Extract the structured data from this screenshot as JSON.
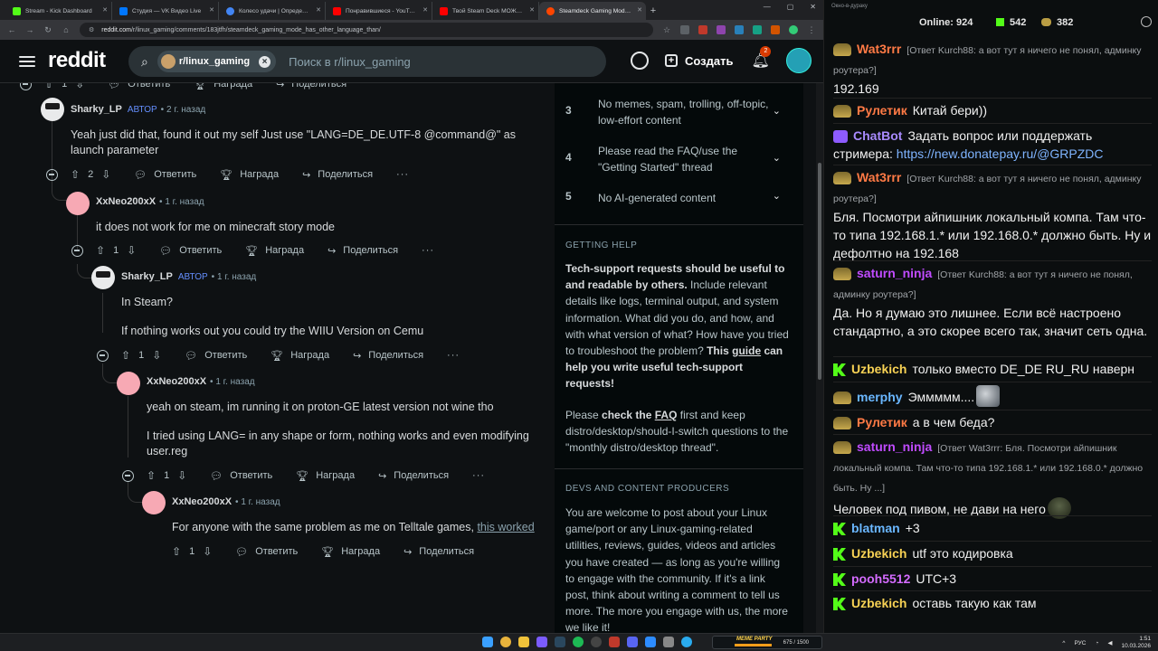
{
  "browser": {
    "tabs": [
      {
        "title": "Stream - Kick Dashboard",
        "color": "#53fc18"
      },
      {
        "title": "Студия — VK Видео Live",
        "color": "#0077ff"
      },
      {
        "title": "Колесо удачи | Определите п...",
        "color": "#4285f4"
      },
      {
        "title": "Понравившиеся - YouTube",
        "color": "#ff0000"
      },
      {
        "title": "Твой Steam Deck МОЖЕТ БОЛ...",
        "color": "#ff0000"
      },
      {
        "title": "Steamdeck Gaming Mode has ...",
        "color": "#ff4500"
      }
    ],
    "url_host": "reddit.com",
    "url_path": "/r/linux_gaming/comments/183jtfh/steamdeck_gaming_mode_has_other_language_than/",
    "chrome_title": "Окно-в-дураку"
  },
  "reddit": {
    "logo": "reddit",
    "subreddit_chip": "r/linux_gaming",
    "search_placeholder": "Поиск в r/linux_gaming",
    "create_label": "Создать",
    "notif_count": "2"
  },
  "comments": [
    {
      "user": "Sharky_LP",
      "op": "АВТОР",
      "time": "2 г. назад",
      "body": [
        "Yeah just did that, found it out my self Just use \"LANG=DE_DE.UTF-8 @command@\" as launch parameter"
      ],
      "votes": "2"
    },
    {
      "user": "XxNeo200xX",
      "op": "",
      "time": "1 г. назад",
      "body": [
        "it does not work for me on minecraft story mode"
      ],
      "votes": "1"
    },
    {
      "user": "Sharky_LP",
      "op": "АВТОР",
      "time": "1 г. назад",
      "body": [
        "In Steam?",
        "If nothing works out you could try the WIIU Version on Cemu"
      ],
      "votes": "1"
    },
    {
      "user": "XxNeo200xX",
      "op": "",
      "time": "1 г. назад",
      "body": [
        "yeah on steam, im running it on proton-GE latest version not wine tho",
        "I tried using LANG= in any shape or form, nothing works and even modifying user.reg"
      ],
      "votes": "1"
    },
    {
      "user": "XxNeo200xX",
      "op": "",
      "time": "1 г. назад",
      "body": [
        "For anyone with the same problem as me on Telltale games,"
      ],
      "link": "this worked",
      "votes": "1"
    }
  ],
  "actions": {
    "reply": "Ответить",
    "award": "Награда",
    "share": "Поделиться",
    "more": "···",
    "top_vote_count": "1"
  },
  "sidebar": {
    "rules": [
      {
        "n": "3",
        "text": "No memes, spam, trolling, off-topic, low-effort content"
      },
      {
        "n": "4",
        "text": "Please read the FAQ/use the \"Getting Started\" thread"
      },
      {
        "n": "5",
        "text": "No AI-generated content"
      }
    ],
    "getting_help_title": "GETTING HELP",
    "gh_bold1": "Tech-support requests should be useful to and readable by others.",
    "gh_text1": " Include relevant details like logs, terminal output, and system information. What did you do, and how, and with what version of what? How have you tried to troubleshoot the problem?",
    "gh_bold2": " This",
    "gh_link": "guide",
    "gh_bold3": " can help you write useful tech-support requests!",
    "gh_p2_a": "Please ",
    "gh_p2_b": "check the",
    "gh_p2_link": "FAQ",
    "gh_p2_c": " first and keep distro/desktop/should-I-switch questions to the \"monthly distro/desktop thread\".",
    "devs_title": "DEVS AND CONTENT PRODUCERS",
    "devs_text": "You are welcome to post about your Linux game/port or any Linux-gaming-related utilities, reviews, guides, videos and articles you have created — as long as you're willing to engage with the community. If it's a link post, think about writing a comment to tell us more. The more you engage with us, the more we like it!"
  },
  "chat": {
    "online_label": "Online:",
    "online_count": "924",
    "kick_count": "542",
    "other_count": "382",
    "messages": [
      {
        "user": "Wat3rrr",
        "color": "#ff7a45",
        "badge": "hat",
        "reply": "[Ответ Kurch88: а вот тут я ничего не понял, админку роутера?]",
        "text": "192.169"
      },
      {
        "user": "Рулетик",
        "color": "#ff7a45",
        "badge": "hat",
        "reply": "",
        "text": "Китай бери))"
      },
      {
        "user": "ChatBot",
        "color": "#a98bff",
        "badge": "bot",
        "reply": "",
        "text": "Задать вопрос или поддержать стримера:",
        "link": "https://new.donatepay.ru/@GRPZDC"
      },
      {
        "user": "Wat3rrr",
        "color": "#ff7a45",
        "badge": "hat",
        "reply": "[Ответ Kurch88: а вот тут я ничего не понял, админку роутера?]",
        "text": "Бля. Посмотри айпишник локальный компа. Там что-то типа 192.168.1.* или 192.168.0.* должно быть. Ну и дефолтно на 192.168"
      },
      {
        "user": "saturn_ninja",
        "color": "#c04bff",
        "badge": "hat",
        "reply": "[Ответ Kurch88: а вот тут я ничего не понял, админку роутера?]",
        "text": "Да. Но я думаю это лишнее. Если всё настроено стандартно, а это скорее всего так, значит сеть одна."
      },
      {
        "user": "Uzbekich",
        "color": "#f7d154",
        "badge": "kk",
        "reply": "",
        "text": "только вместо DE_DE RU_RU наверн"
      },
      {
        "user": "merphy",
        "color": "#6ab7ff",
        "badge": "hat",
        "reply": "",
        "text": "Эммммм...."
      },
      {
        "user": "Рулетик",
        "color": "#ff7a45",
        "badge": "hat",
        "reply": "",
        "text": "а в чем беда?"
      },
      {
        "user": "saturn_ninja",
        "color": "#c04bff",
        "badge": "hat",
        "reply": "[Ответ Wat3rrr: Бля. Посмотри айпишник локальный компа. Там что-то типа 192.168.1.* или 192.168.0.* должно быть. Ну ...]",
        "text": "Человек под пивом, не дави на него"
      },
      {
        "user": "blatman",
        "color": "#6ab7ff",
        "badge": "kk",
        "reply": "",
        "text": "+3"
      },
      {
        "user": "Uzbekich",
        "color": "#f7d154",
        "badge": "kk",
        "reply": "",
        "text": "utf это кодировка"
      },
      {
        "user": "pooh5512",
        "color": "#d46bff",
        "badge": "kk",
        "reply": "",
        "text": "UTC+3"
      },
      {
        "user": "Uzbekich",
        "color": "#f7d154",
        "badge": "kk",
        "reply": "",
        "text": "оставь такую как там"
      }
    ]
  },
  "taskbar": {
    "party_label": "MEME PARTY",
    "party_value": "675 / 1500",
    "party_progress": 0.45,
    "lang": "РУС",
    "time": "1:51",
    "date": "10.03.2026"
  }
}
